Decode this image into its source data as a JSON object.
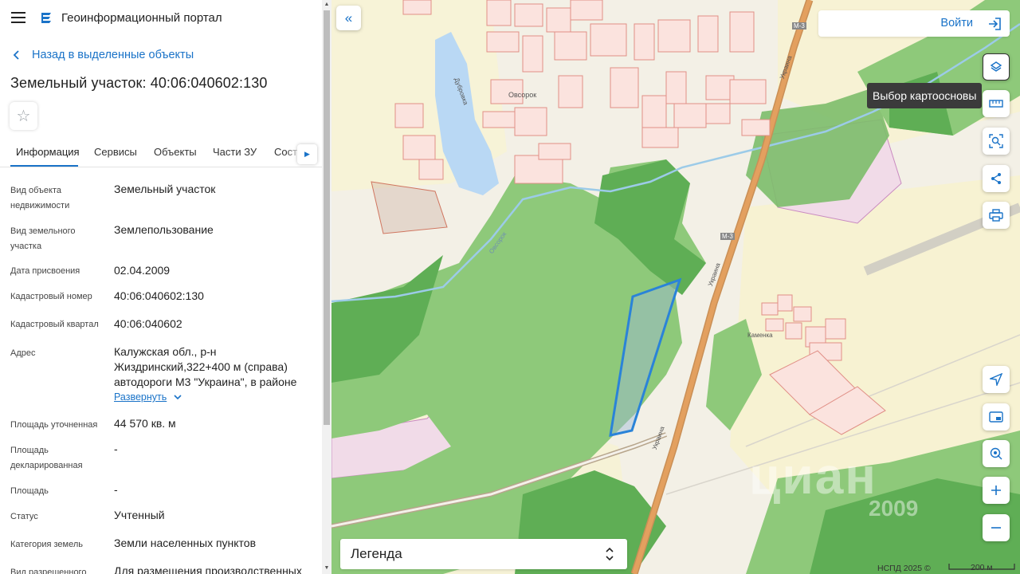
{
  "app": {
    "title": "Геоинформационный портал"
  },
  "navigation": {
    "back_link": "Назад в выделенные объекты"
  },
  "object": {
    "title": "Земельный участок: 40:06:040602:130"
  },
  "tabs": [
    {
      "label": "Информация",
      "active": true
    },
    {
      "label": "Сервисы",
      "active": false
    },
    {
      "label": "Объекты",
      "active": false
    },
    {
      "label": "Части ЗУ",
      "active": false
    },
    {
      "label": "Соста",
      "active": false
    }
  ],
  "details": [
    {
      "label": "Вид объекта недвижимости",
      "value": "Земельный участок"
    },
    {
      "label": "Вид земельного участка",
      "value": "Землепользование"
    },
    {
      "label": "Дата присвоения",
      "value": "02.04.2009"
    },
    {
      "label": "Кадастровый номер",
      "value": "40:06:040602:130"
    },
    {
      "label": "Кадастровый квартал",
      "value": "40:06:040602"
    },
    {
      "label": "Адрес",
      "value": "Калужская обл., р-н Жиздринский,322+400 м (справа) автодороги М3 \"Украина\", в районе"
    },
    {
      "label": "Площадь уточненная",
      "value": "44 570 кв. м"
    },
    {
      "label": "Площадь декларированная",
      "value": "-"
    },
    {
      "label": "Площадь",
      "value": "-"
    },
    {
      "label": "Статус",
      "value": "Учтенный"
    },
    {
      "label": "Категория земель",
      "value": "Земли населенных пунктов"
    },
    {
      "label": "Вид разрешенного",
      "value": "Для размещения производственных"
    }
  ],
  "expand_label": "Развернуть",
  "map": {
    "login_label": "Войти",
    "tooltip": "Выбор картоосновы",
    "legend_label": "Легенда",
    "attribution": "НСПД 2025 ©",
    "scale_label": "200 м",
    "watermark": "циан",
    "watermark_year": "2009",
    "place_labels": [
      "Овсорок",
      "Каменка",
      "Дубровка",
      "Овсорок",
      "Украина",
      "Украина",
      "Украина",
      "М-3",
      "М-3"
    ],
    "tools": [
      "layers-icon",
      "ruler-icon",
      "search-area-icon",
      "share-icon",
      "print-icon",
      "locate-icon",
      "minimap-icon",
      "geo-target-icon",
      "zoom-in-icon",
      "zoom-out-icon"
    ]
  },
  "colors": {
    "accent": "#1a73c8",
    "forest": "#8ec97a",
    "forest_dark": "#5fae55",
    "parcel_outline": "#2a83d8",
    "road": "#e3a05f"
  }
}
